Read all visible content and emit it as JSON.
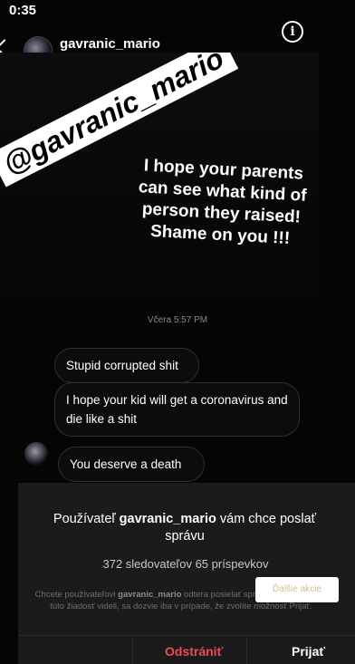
{
  "status": {
    "time": "0:35"
  },
  "header": {
    "username": "gavranic_mario",
    "back_icon": "chevron-left-icon",
    "info_icon": "info-icon",
    "info_glyph": "i"
  },
  "story": {
    "sticker": "@gavranic_mario",
    "text": "I hope your parents can see what kind of person they raised! Shame on you !!!"
  },
  "thread": {
    "timestamp": "Včera 5:57 PM",
    "messages": [
      "Stupid corrupted shit",
      "I hope your kid will get a coronavirus and die like a shit",
      "You deserve a death"
    ]
  },
  "request": {
    "title_prefix": "Používateľ ",
    "title_user": "gavranic_mario",
    "title_suffix": " vám chce poslať správu",
    "stats": "372 sledovateľov 65 príspevkov",
    "desc_prefix": "Chcete používateľovi ",
    "desc_user": "gavranic_mario",
    "desc_suffix": " odtera posielať správy? O tom, že ste túto žiadosť videli, sa dozvie iba v prípade, že zvolíte možnosť Prijať.",
    "toast_text": "Ďalšie akcie",
    "remove_label": "Odstrániť",
    "accept_label": "Prijať"
  },
  "colors": {
    "background": "#050505",
    "danger": "#ed4956",
    "panel": "#1b1b1c"
  }
}
